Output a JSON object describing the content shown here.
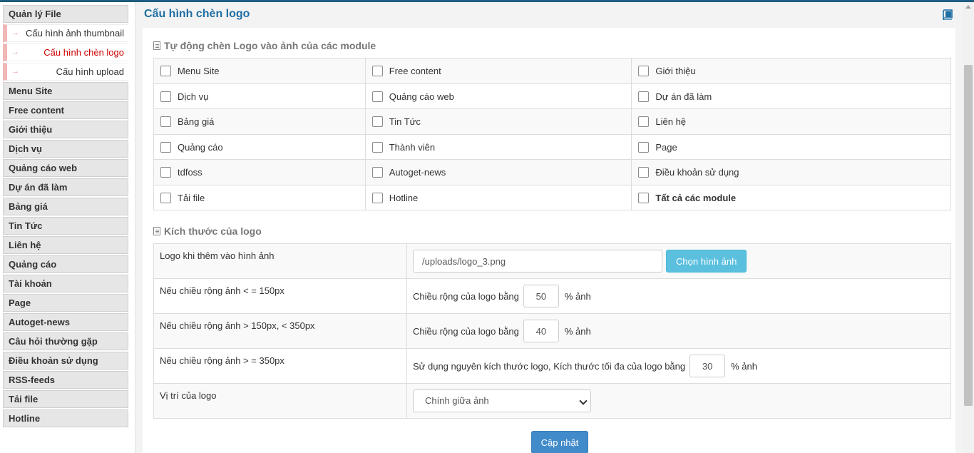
{
  "sidebar": {
    "items": [
      {
        "label": "Quản lý File",
        "type": "section"
      },
      {
        "label": "Cấu hình ảnh thumbnail",
        "type": "sub"
      },
      {
        "label": "Cấu hình chèn logo",
        "type": "sub-active"
      },
      {
        "label": "Cấu hình upload",
        "type": "sub"
      },
      {
        "label": "Menu Site",
        "type": "section"
      },
      {
        "label": "Free content",
        "type": "section"
      },
      {
        "label": "Giới thiệu",
        "type": "section"
      },
      {
        "label": "Dịch vụ",
        "type": "section"
      },
      {
        "label": "Quảng cáo web",
        "type": "section"
      },
      {
        "label": "Dự án đã làm",
        "type": "section"
      },
      {
        "label": "Bảng giá",
        "type": "section"
      },
      {
        "label": "Tin Tức",
        "type": "section"
      },
      {
        "label": "Liên hệ",
        "type": "section"
      },
      {
        "label": "Quảng cáo",
        "type": "section"
      },
      {
        "label": "Tài khoản",
        "type": "section"
      },
      {
        "label": "Page",
        "type": "section"
      },
      {
        "label": "Autoget-news",
        "type": "section"
      },
      {
        "label": "Câu hỏi thường gặp",
        "type": "section"
      },
      {
        "label": "Điều khoản sử dụng",
        "type": "section"
      },
      {
        "label": "RSS-feeds",
        "type": "section"
      },
      {
        "label": "Tải file",
        "type": "section"
      },
      {
        "label": "Hotline",
        "type": "section"
      }
    ]
  },
  "header": {
    "title": "Cấu hình chèn logo",
    "icon": "book-icon"
  },
  "modules": {
    "title": "Tự động chèn Logo vào ảnh của các module",
    "rows": [
      [
        {
          "label": "Menu Site",
          "checked": false
        },
        {
          "label": "Free content",
          "checked": false
        },
        {
          "label": "Giới thiệu",
          "checked": false
        }
      ],
      [
        {
          "label": "Dịch vụ",
          "checked": false
        },
        {
          "label": "Quảng cáo web",
          "checked": false
        },
        {
          "label": "Dự án đã làm",
          "checked": false
        }
      ],
      [
        {
          "label": "Bảng giá",
          "checked": false
        },
        {
          "label": "Tin Tức",
          "checked": false
        },
        {
          "label": "Liên hệ",
          "checked": false
        }
      ],
      [
        {
          "label": "Quảng cáo",
          "checked": false
        },
        {
          "label": "Thành viên",
          "checked": false
        },
        {
          "label": "Page",
          "checked": false
        }
      ],
      [
        {
          "label": "tdfoss",
          "checked": false
        },
        {
          "label": "Autoget-news",
          "checked": false
        },
        {
          "label": "Điều khoản sử dụng",
          "checked": false
        }
      ],
      [
        {
          "label": "Tải file",
          "checked": false
        },
        {
          "label": "Hotline",
          "checked": false
        },
        {
          "label": "Tất cả các module",
          "checked": false
        }
      ]
    ]
  },
  "sizes": {
    "title": "Kích thước của logo",
    "logo_label": "Logo khi thêm vào hình ảnh",
    "logo_path": "/uploads/logo_3.png",
    "choose_button": "Chọn hình ảnh",
    "row1_label": "Nếu chiều rộng ảnh < = 150px",
    "row1_prefix": "Chiều rộng của logo bằng",
    "row1_value": "50",
    "row1_suffix": "% ảnh",
    "row2_label": "Nếu chiều rộng ảnh > 150px, < 350px",
    "row2_prefix": "Chiều rộng của logo bằng",
    "row2_value": "40",
    "row2_suffix": "% ảnh",
    "row3_label": "Nếu chiều rộng ảnh > = 350px",
    "row3_prefix": "Sử dụng nguyên kích thước logo, Kích thước tối đa của logo bằng",
    "row3_value": "30",
    "row3_suffix": "% ảnh",
    "position_label": "Vị trí của logo",
    "position_value": "Chính giữa ảnh"
  },
  "actions": {
    "update_button": "Cập nhật"
  },
  "colors": {
    "title": "#1f6fa5",
    "active_link": "#cc0000",
    "choose_button_bg": "#5bc0de",
    "update_button_bg": "#428bca"
  }
}
